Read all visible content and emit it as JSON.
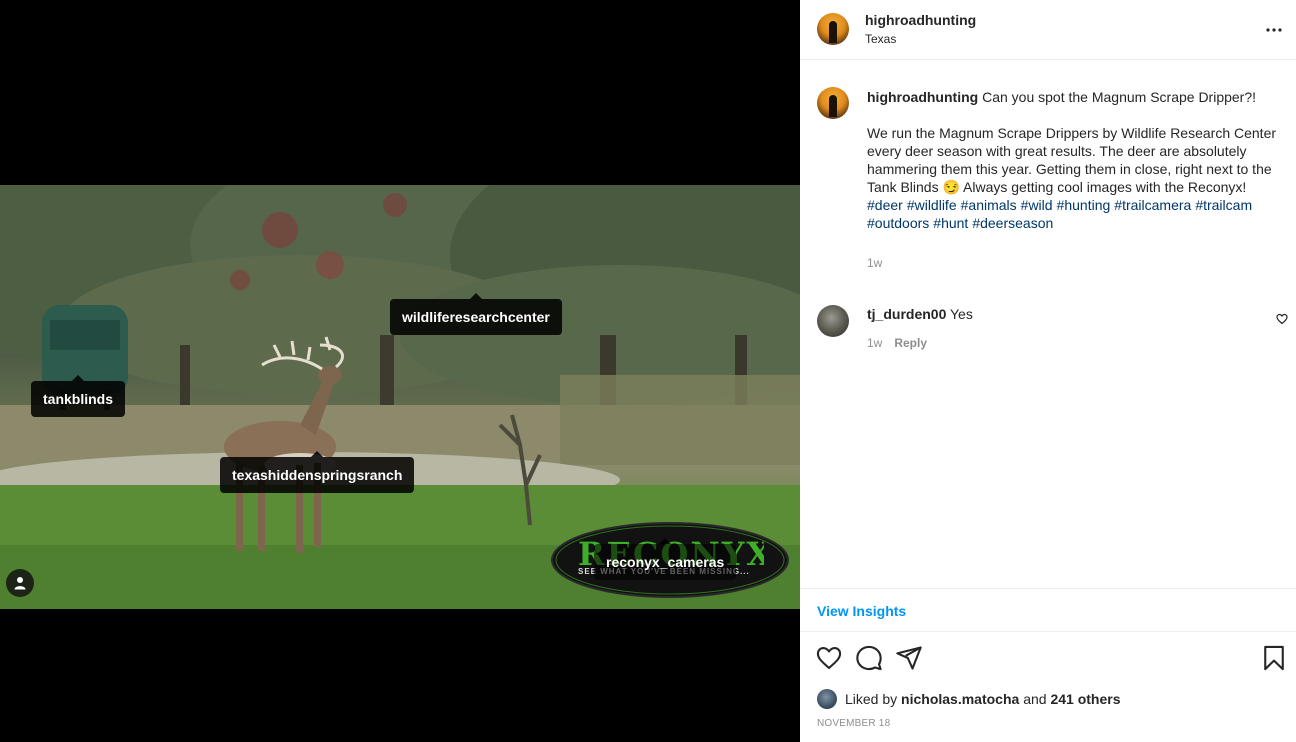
{
  "header": {
    "username": "highroadhunting",
    "location": "Texas"
  },
  "caption": {
    "username": "highroadhunting",
    "lead": "Can you spot the Magnum Scrape Dripper?!",
    "body": "We run the Magnum Scrape Drippers by Wildlife Research Center every deer season with great results. The deer are absolutely hammering them this year. Getting them in close, right next to the Tank Blinds 😏 Always getting cool images with the Reconyx!",
    "hashtags": [
      "#deer",
      "#wildlife",
      "#animals",
      "#wild",
      "#hunting",
      "#trailcamera",
      "#trailcam",
      "#outdoors",
      "#hunt",
      "#deerseason"
    ],
    "time": "1w"
  },
  "comments": [
    {
      "username": "tj_durden00",
      "text": "Yes",
      "time": "1w",
      "reply_label": "Reply"
    }
  ],
  "photo_tags": {
    "tag1": "wildliferesearchcenter",
    "tag2": "tankblinds",
    "tag3": "texashiddenspringsranch",
    "tag4": "reconyx_cameras"
  },
  "watermark": {
    "brand": "RECONYX",
    "tagline": "SEE WHAT YOU'VE BEEN MISSING..."
  },
  "insights_label": "View Insights",
  "likes": {
    "prefix": "Liked by",
    "user": "nicholas.matocha",
    "joiner": "and",
    "others": "241 others"
  },
  "date": "NOVEMBER 18",
  "icons": {
    "more": "more-horizontal-icon",
    "like": "heart-icon",
    "comment": "comment-icon",
    "share": "paper-plane-icon",
    "save": "bookmark-icon",
    "user_tags": "person-icon"
  },
  "colors": {
    "link_blue": "#0095f6",
    "hashtag": "#00376b",
    "muted": "#8e8e8e",
    "reconyx_green": "#3fae29"
  }
}
